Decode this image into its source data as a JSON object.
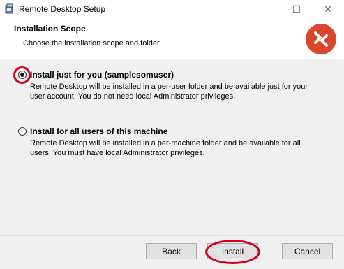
{
  "window": {
    "title": "Remote Desktop Setup",
    "controls": {
      "minimize": "–",
      "maximize": "☐",
      "close": "✕"
    }
  },
  "header": {
    "title": "Installation Scope",
    "subtitle": "Choose the installation scope and folder",
    "logo_icon": "remote-desktop-logo-icon"
  },
  "options": [
    {
      "label": "Install just for you (samplesomuser)",
      "description": "Remote Desktop will be installed in a per-user folder and be available just for your user account. You do not need local Administrator privileges.",
      "selected": true
    },
    {
      "label": "Install for all users of this machine",
      "description": "Remote Desktop will be installed in a per-machine folder and be available for all users. You must have local Administrator privileges.",
      "selected": false
    }
  ],
  "buttons": {
    "back": "Back",
    "install": "Install",
    "cancel": "Cancel"
  },
  "colors": {
    "accent": "#d0021b",
    "logo_bg": "#d9472b"
  }
}
